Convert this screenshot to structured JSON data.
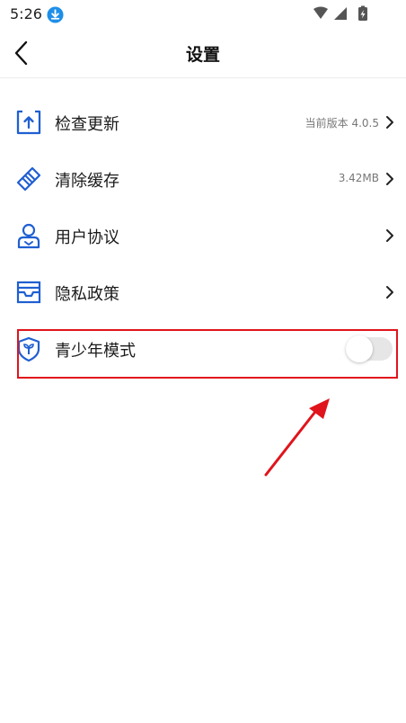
{
  "status_bar": {
    "time": "5:26"
  },
  "header": {
    "title": "设置"
  },
  "settings": {
    "check_update": {
      "label": "检查更新",
      "value": "当前版本 4.0.5",
      "icon": "upload-icon"
    },
    "clear_cache": {
      "label": "清除缓存",
      "value": "3.42MB",
      "icon": "broom-icon"
    },
    "user_agreement": {
      "label": "用户协议",
      "icon": "user-icon"
    },
    "privacy_policy": {
      "label": "隐私政策",
      "icon": "tray-icon"
    },
    "youth_mode": {
      "label": "青少年模式",
      "icon": "shield-sprout-icon",
      "enabled": false
    }
  },
  "colors": {
    "accent": "#1f5fd1",
    "annotation": "#e0141c",
    "toggle_off": "#e6e6e6"
  }
}
